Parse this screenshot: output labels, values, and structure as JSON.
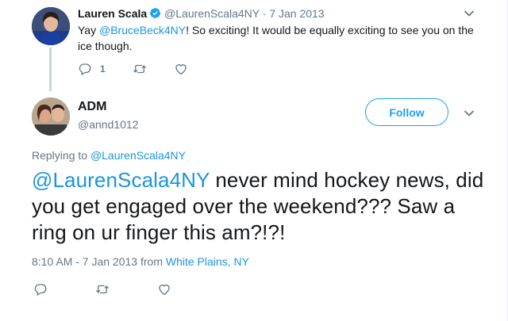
{
  "parent_tweet": {
    "name": "Lauren Scala",
    "handle": "@LaurenScala4NY",
    "separator": "·",
    "date": "7 Jan 2013",
    "text_prefix": "Yay ",
    "mention": "@BruceBeck4NY",
    "text_suffix": "! So exciting! It would be equally exciting to see you on the ice though.",
    "reply_count": "1"
  },
  "main_tweet": {
    "name": "ADM",
    "handle": "@annd1012",
    "follow_label": "Follow",
    "replying_prefix": "Replying to ",
    "replying_handle": "@LaurenScala4NY",
    "mention": "@LaurenScala4NY",
    "text": " never mind hockey news, did you get engaged over the weekend??? Saw a ring on ur finger this am?!?!",
    "timestamp": "8:10 AM - 7 Jan 2013 from ",
    "location": "White Plains, NY"
  },
  "colors": {
    "accent": "#1da1f2",
    "link": "#1b95e0",
    "secondary_text": "#657786",
    "thread_line": "#ccd6dd"
  },
  "icons": [
    "verified-badge-icon",
    "chevron-down-icon",
    "reply-icon",
    "retweet-icon",
    "like-icon"
  ]
}
